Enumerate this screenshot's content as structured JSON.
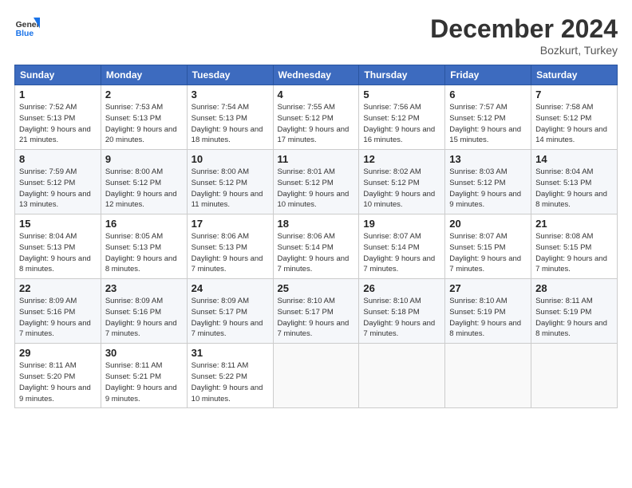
{
  "header": {
    "logo_line1": "General",
    "logo_line2": "Blue",
    "month": "December 2024",
    "location": "Bozkurt, Turkey"
  },
  "weekdays": [
    "Sunday",
    "Monday",
    "Tuesday",
    "Wednesday",
    "Thursday",
    "Friday",
    "Saturday"
  ],
  "weeks": [
    [
      {
        "day": "1",
        "sunrise": "7:52 AM",
        "sunset": "5:13 PM",
        "daylight": "9 hours and 21 minutes."
      },
      {
        "day": "2",
        "sunrise": "7:53 AM",
        "sunset": "5:13 PM",
        "daylight": "9 hours and 20 minutes."
      },
      {
        "day": "3",
        "sunrise": "7:54 AM",
        "sunset": "5:13 PM",
        "daylight": "9 hours and 18 minutes."
      },
      {
        "day": "4",
        "sunrise": "7:55 AM",
        "sunset": "5:12 PM",
        "daylight": "9 hours and 17 minutes."
      },
      {
        "day": "5",
        "sunrise": "7:56 AM",
        "sunset": "5:12 PM",
        "daylight": "9 hours and 16 minutes."
      },
      {
        "day": "6",
        "sunrise": "7:57 AM",
        "sunset": "5:12 PM",
        "daylight": "9 hours and 15 minutes."
      },
      {
        "day": "7",
        "sunrise": "7:58 AM",
        "sunset": "5:12 PM",
        "daylight": "9 hours and 14 minutes."
      }
    ],
    [
      {
        "day": "8",
        "sunrise": "7:59 AM",
        "sunset": "5:12 PM",
        "daylight": "9 hours and 13 minutes."
      },
      {
        "day": "9",
        "sunrise": "8:00 AM",
        "sunset": "5:12 PM",
        "daylight": "9 hours and 12 minutes."
      },
      {
        "day": "10",
        "sunrise": "8:00 AM",
        "sunset": "5:12 PM",
        "daylight": "9 hours and 11 minutes."
      },
      {
        "day": "11",
        "sunrise": "8:01 AM",
        "sunset": "5:12 PM",
        "daylight": "9 hours and 10 minutes."
      },
      {
        "day": "12",
        "sunrise": "8:02 AM",
        "sunset": "5:12 PM",
        "daylight": "9 hours and 10 minutes."
      },
      {
        "day": "13",
        "sunrise": "8:03 AM",
        "sunset": "5:12 PM",
        "daylight": "9 hours and 9 minutes."
      },
      {
        "day": "14",
        "sunrise": "8:04 AM",
        "sunset": "5:13 PM",
        "daylight": "9 hours and 8 minutes."
      }
    ],
    [
      {
        "day": "15",
        "sunrise": "8:04 AM",
        "sunset": "5:13 PM",
        "daylight": "9 hours and 8 minutes."
      },
      {
        "day": "16",
        "sunrise": "8:05 AM",
        "sunset": "5:13 PM",
        "daylight": "9 hours and 8 minutes."
      },
      {
        "day": "17",
        "sunrise": "8:06 AM",
        "sunset": "5:13 PM",
        "daylight": "9 hours and 7 minutes."
      },
      {
        "day": "18",
        "sunrise": "8:06 AM",
        "sunset": "5:14 PM",
        "daylight": "9 hours and 7 minutes."
      },
      {
        "day": "19",
        "sunrise": "8:07 AM",
        "sunset": "5:14 PM",
        "daylight": "9 hours and 7 minutes."
      },
      {
        "day": "20",
        "sunrise": "8:07 AM",
        "sunset": "5:15 PM",
        "daylight": "9 hours and 7 minutes."
      },
      {
        "day": "21",
        "sunrise": "8:08 AM",
        "sunset": "5:15 PM",
        "daylight": "9 hours and 7 minutes."
      }
    ],
    [
      {
        "day": "22",
        "sunrise": "8:09 AM",
        "sunset": "5:16 PM",
        "daylight": "9 hours and 7 minutes."
      },
      {
        "day": "23",
        "sunrise": "8:09 AM",
        "sunset": "5:16 PM",
        "daylight": "9 hours and 7 minutes."
      },
      {
        "day": "24",
        "sunrise": "8:09 AM",
        "sunset": "5:17 PM",
        "daylight": "9 hours and 7 minutes."
      },
      {
        "day": "25",
        "sunrise": "8:10 AM",
        "sunset": "5:17 PM",
        "daylight": "9 hours and 7 minutes."
      },
      {
        "day": "26",
        "sunrise": "8:10 AM",
        "sunset": "5:18 PM",
        "daylight": "9 hours and 7 minutes."
      },
      {
        "day": "27",
        "sunrise": "8:10 AM",
        "sunset": "5:19 PM",
        "daylight": "9 hours and 8 minutes."
      },
      {
        "day": "28",
        "sunrise": "8:11 AM",
        "sunset": "5:19 PM",
        "daylight": "9 hours and 8 minutes."
      }
    ],
    [
      {
        "day": "29",
        "sunrise": "8:11 AM",
        "sunset": "5:20 PM",
        "daylight": "9 hours and 9 minutes."
      },
      {
        "day": "30",
        "sunrise": "8:11 AM",
        "sunset": "5:21 PM",
        "daylight": "9 hours and 9 minutes."
      },
      {
        "day": "31",
        "sunrise": "8:11 AM",
        "sunset": "5:22 PM",
        "daylight": "9 hours and 10 minutes."
      },
      null,
      null,
      null,
      null
    ]
  ],
  "labels": {
    "sunrise": "Sunrise:",
    "sunset": "Sunset:",
    "daylight": "Daylight:"
  }
}
